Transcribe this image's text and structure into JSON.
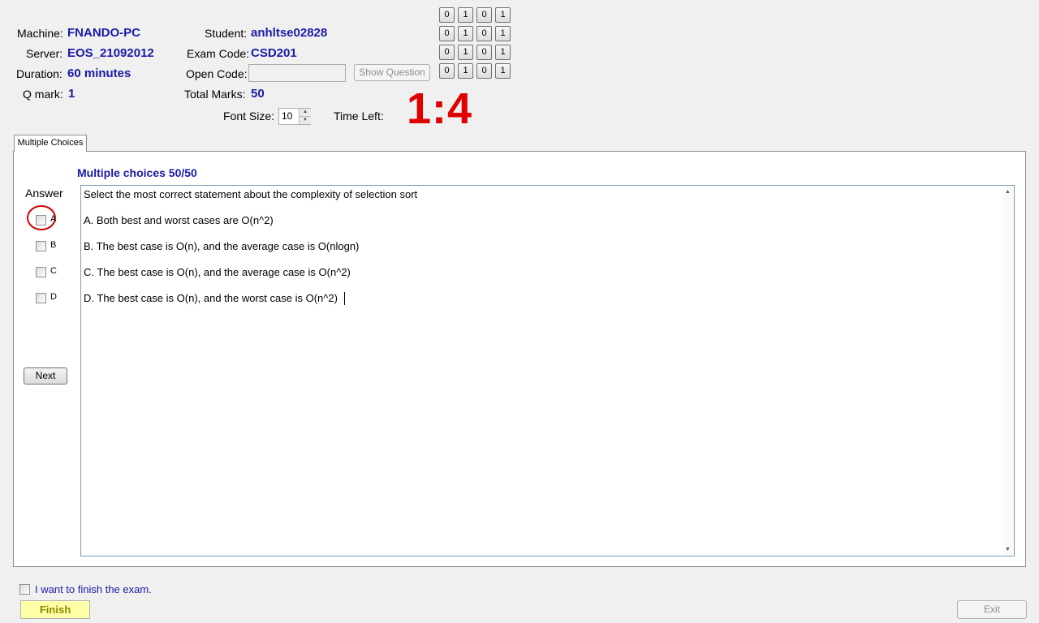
{
  "header": {
    "machine_label": "Machine:",
    "machine_value": "FNANDO-PC",
    "server_label": "Server:",
    "server_value": "EOS_21092012",
    "duration_label": "Duration:",
    "duration_value": "60 minutes",
    "qmark_label": "Q mark:",
    "qmark_value": "1",
    "student_label": "Student:",
    "student_value": "anhltse02828",
    "exam_code_label": "Exam Code:",
    "exam_code_value": "CSD201",
    "open_code_label": "Open Code:",
    "open_code_value": "",
    "show_question_label": "Show Question",
    "total_marks_label": "Total Marks:",
    "total_marks_value": "50",
    "font_size_label": "Font Size:",
    "font_size_value": "10",
    "time_left_label": "Time Left:",
    "time_left_value": "1:4"
  },
  "bit_grid": [
    [
      "0",
      "1",
      "0",
      "1"
    ],
    [
      "0",
      "1",
      "0",
      "1"
    ],
    [
      "0",
      "1",
      "0",
      "1"
    ],
    [
      "0",
      "1",
      "0",
      "1"
    ]
  ],
  "tab": {
    "label": "Multiple Choices"
  },
  "question": {
    "heading": "Multiple choices 50/50",
    "answer_label": "Answer",
    "options": [
      "A",
      "B",
      "C",
      "D"
    ],
    "stem": "Select the most correct statement about the complexity of selection sort",
    "choices": [
      "A.  Both best  and worst cases are  O(n^2)",
      "B.  The best case is O(n), and the average case is  O(nlogn)",
      "C.  The best case is O(n), and the average case is  O(n^2)",
      "D.  The best case is O(n), and the worst case is  O(n^2)"
    ],
    "next_label": "Next"
  },
  "footer": {
    "finish_checkbox_label": "I want to finish the exam.",
    "finish_label": "Finish",
    "exit_label": "Exit"
  },
  "colors": {
    "value_blue": "#1a1aa6",
    "timer_red": "#e00000",
    "finish_yellow": "#ffffa8",
    "annotation_red": "#d40000"
  }
}
